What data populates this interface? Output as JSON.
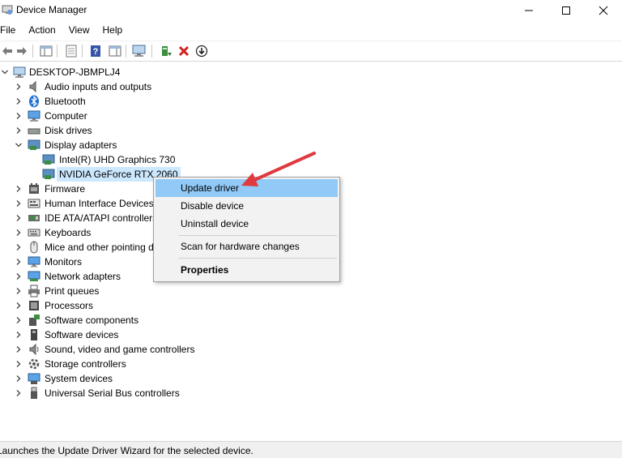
{
  "window": {
    "title": "Device Manager"
  },
  "menu": [
    "File",
    "Action",
    "View",
    "Help"
  ],
  "tree": {
    "root": "DESKTOP-JBMPLJ4",
    "items": [
      {
        "label": "Audio inputs and outputs",
        "icon": "speaker-icon",
        "expanded": false
      },
      {
        "label": "Bluetooth",
        "icon": "bluetooth-icon",
        "expanded": false
      },
      {
        "label": "Computer",
        "icon": "computer-icon",
        "expanded": false
      },
      {
        "label": "Disk drives",
        "icon": "disk-drive-icon",
        "expanded": false
      },
      {
        "label": "Display adapters",
        "icon": "display-adapter-icon",
        "expanded": true
      },
      {
        "label": "Intel(R) UHD Graphics 730",
        "icon": "display-adapter-icon",
        "child": true
      },
      {
        "label": "NVIDIA GeForce RTX 2060",
        "icon": "display-adapter-icon",
        "child": true,
        "selected": true
      },
      {
        "label": "Firmware",
        "icon": "firmware-icon",
        "expanded": false
      },
      {
        "label": "Human Interface Devices",
        "icon": "hid-icon",
        "expanded": false
      },
      {
        "label": "IDE ATA/ATAPI controllers",
        "icon": "ide-controller-icon",
        "expanded": false
      },
      {
        "label": "Keyboards",
        "icon": "keyboard-icon",
        "expanded": false
      },
      {
        "label": "Mice and other pointing devices",
        "icon": "mouse-icon",
        "expanded": false
      },
      {
        "label": "Monitors",
        "icon": "monitor-icon",
        "expanded": false
      },
      {
        "label": "Network adapters",
        "icon": "network-adapter-icon",
        "expanded": false
      },
      {
        "label": "Print queues",
        "icon": "printer-icon",
        "expanded": false
      },
      {
        "label": "Processors",
        "icon": "processor-icon",
        "expanded": false
      },
      {
        "label": "Software components",
        "icon": "software-component-icon",
        "expanded": false
      },
      {
        "label": "Software devices",
        "icon": "software-device-icon",
        "expanded": false
      },
      {
        "label": "Sound, video and game controllers",
        "icon": "sound-controller-icon",
        "expanded": false
      },
      {
        "label": "Storage controllers",
        "icon": "storage-controller-icon",
        "expanded": false
      },
      {
        "label": "System devices",
        "icon": "system-device-icon",
        "expanded": false
      },
      {
        "label": "Universal Serial Bus controllers",
        "icon": "usb-icon",
        "expanded": false
      }
    ]
  },
  "context_menu": {
    "update_driver": "Update driver",
    "disable_device": "Disable device",
    "uninstall_device": "Uninstall device",
    "scan_hardware": "Scan for hardware changes",
    "properties": "Properties"
  },
  "status": "Launches the Update Driver Wizard for the selected device.",
  "colors": {
    "selection": "#cce8ff",
    "menu_highlight": "#91c9f7",
    "arrow": "#e0393e"
  }
}
